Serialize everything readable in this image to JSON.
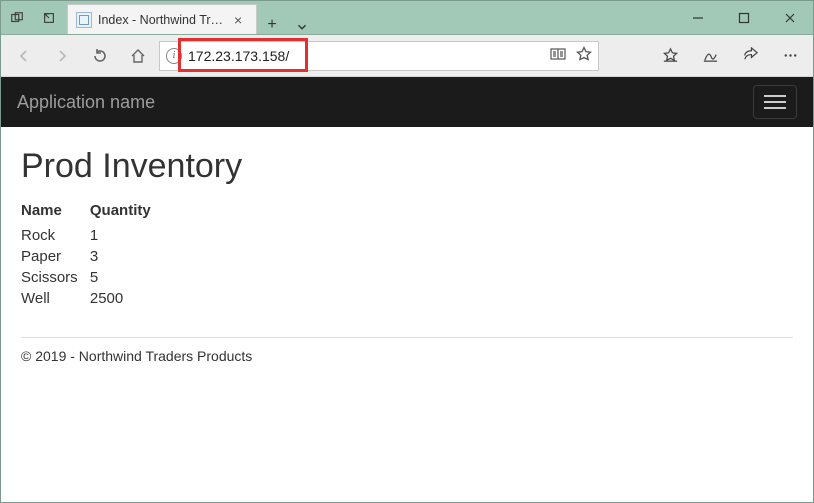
{
  "browser": {
    "tab_title": "Index - Northwind Traders",
    "address_url": "172.23.173.158/"
  },
  "navbar": {
    "brand": "Application name"
  },
  "page": {
    "heading": "Prod Inventory",
    "columns": {
      "name": "Name",
      "quantity": "Quantity"
    },
    "rows": [
      {
        "name": "Rock",
        "quantity": "1"
      },
      {
        "name": "Paper",
        "quantity": "3"
      },
      {
        "name": "Scissors",
        "quantity": "5"
      },
      {
        "name": "Well",
        "quantity": "2500"
      }
    ],
    "footer": "© 2019 - Northwind Traders Products"
  }
}
